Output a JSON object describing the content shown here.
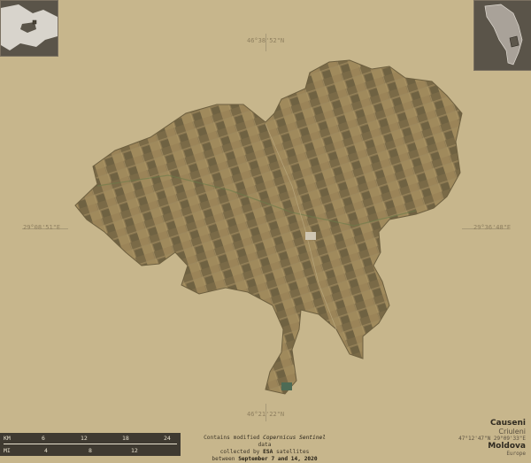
{
  "map": {
    "coords": {
      "top": "46°38'52\"N",
      "bottom": "46°21'22\"N",
      "left": "29°08'51\"E",
      "right": "29°36'48\"E"
    },
    "region_name": "Causeni",
    "alt_name": "Criuleni",
    "center_coords": "47°12'47\"N 29°09'33\"E",
    "country": "Moldova",
    "continent": "Europe",
    "attribution": {
      "line1_pre": "Contains modified ",
      "line1_em": "Copernicus Sentinel",
      "line1_post": " data",
      "line2_pre": "collected by ",
      "line2_em": "ESA",
      "line2_post": " satellites",
      "line3_pre": "between ",
      "line3_em": "September 7 and 14, 2020"
    },
    "scale": {
      "km_label": "KM",
      "mi_label": "MI",
      "km_ticks": [
        "6",
        "12",
        "18",
        "24"
      ],
      "mi_ticks": [
        "4",
        "8",
        "12"
      ]
    },
    "colors": {
      "background": "#c7b68c",
      "region_fill": "#8c7a52",
      "inset_bg": "#5a5449"
    }
  }
}
